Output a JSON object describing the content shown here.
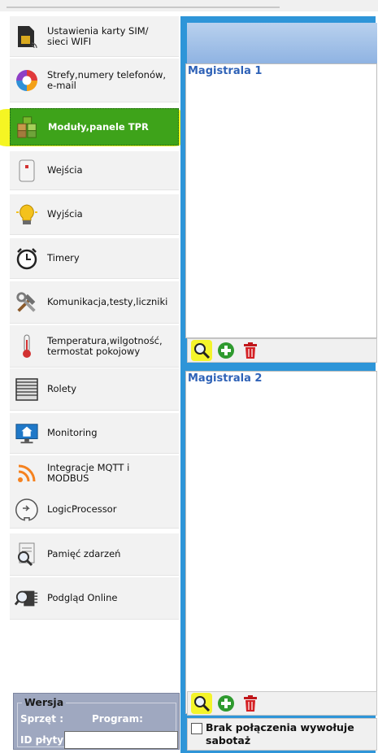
{
  "nav": {
    "items": [
      {
        "label": "Ustawienia karty SIM/\nsieci WIFI",
        "icon": "sim-wifi-icon"
      },
      {
        "label": "Strefy,numery telefonów,\ne-mail",
        "icon": "zones-pie-icon"
      },
      {
        "label": "Moduły,panele TPR",
        "icon": "modules-cubes-icon"
      },
      {
        "label": "Wejścia",
        "icon": "sensor-icon"
      },
      {
        "label": "Wyjścia",
        "icon": "lightbulb-icon"
      },
      {
        "label": "Timery",
        "icon": "alarm-clock-icon"
      },
      {
        "label": "Komunikacja,testy,liczniki",
        "icon": "tools-icon"
      },
      {
        "label": "Temperatura,wilgotność,\ntermostat pokojowy",
        "icon": "thermometer-icon"
      },
      {
        "label": "Rolety",
        "icon": "shutter-icon"
      },
      {
        "label": "Monitoring",
        "icon": "monitor-house-icon"
      },
      {
        "label": "Integracje MQTT i\nMODBUS",
        "icon": "rss-icon"
      },
      {
        "label": "LogicProcessor",
        "icon": "logic-processor-icon"
      },
      {
        "label": "Pamięć zdarzeń",
        "icon": "event-memory-icon"
      },
      {
        "label": "Podgląd Online",
        "icon": "online-preview-icon"
      }
    ],
    "active_index": 2
  },
  "version": {
    "title": "Wersja",
    "sprzet_label": "Sprzęt :",
    "program_label": "Program:",
    "id_label": "ID płyty",
    "id_value": ""
  },
  "magistrala": {
    "title1": "Magistrala 1",
    "title2": "Magistrala 2"
  },
  "checkbox": {
    "label": "Brak połączenia wywołuje sabotaż",
    "checked": false
  },
  "colors": {
    "accent_blue": "#2e95d8",
    "active_green": "#3ea31a",
    "highlight_yellow": "#f5f523",
    "title_blue": "#2f62b7"
  }
}
